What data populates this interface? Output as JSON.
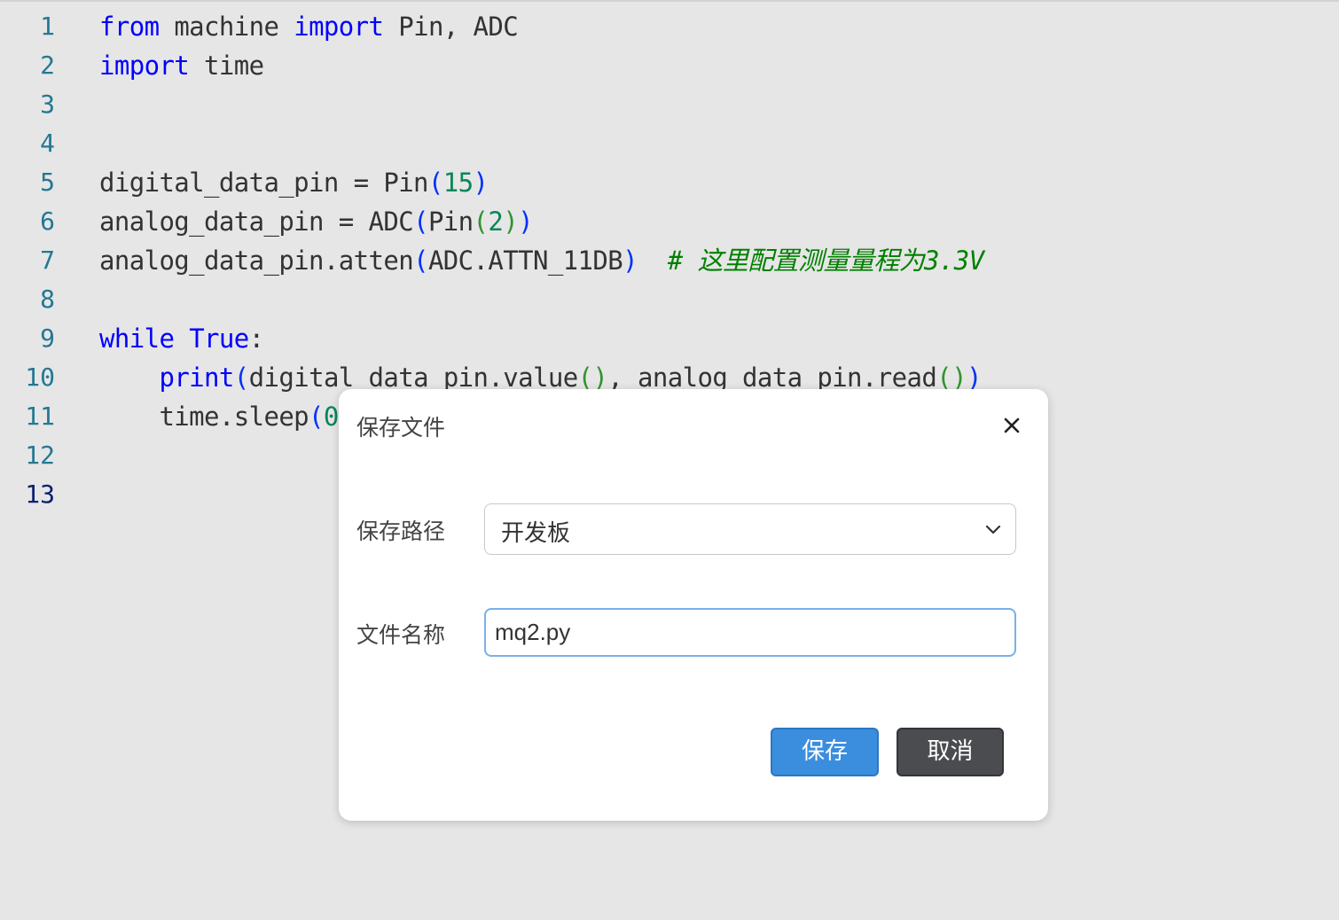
{
  "editor": {
    "lines": [
      {
        "number": "1",
        "tokens": [
          {
            "text": "from",
            "cls": "kw"
          },
          {
            "text": " machine ",
            "cls": ""
          },
          {
            "text": "import",
            "cls": "kw"
          },
          {
            "text": " Pin, ADC",
            "cls": ""
          }
        ]
      },
      {
        "number": "2",
        "tokens": [
          {
            "text": "import",
            "cls": "kw"
          },
          {
            "text": " time",
            "cls": ""
          }
        ]
      },
      {
        "number": "3",
        "tokens": []
      },
      {
        "number": "4",
        "tokens": []
      },
      {
        "number": "5",
        "tokens": [
          {
            "text": "digital_data_pin = Pin",
            "cls": ""
          },
          {
            "text": "(",
            "cls": "p1"
          },
          {
            "text": "15",
            "cls": "num"
          },
          {
            "text": ")",
            "cls": "p1"
          }
        ]
      },
      {
        "number": "6",
        "tokens": [
          {
            "text": "analog_data_pin = ADC",
            "cls": ""
          },
          {
            "text": "(",
            "cls": "p1"
          },
          {
            "text": "Pin",
            "cls": ""
          },
          {
            "text": "(",
            "cls": "p2"
          },
          {
            "text": "2",
            "cls": "num"
          },
          {
            "text": ")",
            "cls": "p2"
          },
          {
            "text": ")",
            "cls": "p1"
          }
        ]
      },
      {
        "number": "7",
        "tokens": [
          {
            "text": "analog_data_pin.atten",
            "cls": ""
          },
          {
            "text": "(",
            "cls": "p1"
          },
          {
            "text": "ADC.ATTN_11DB",
            "cls": ""
          },
          {
            "text": ")",
            "cls": "p1"
          },
          {
            "text": "  # 这里配置测量量程为3.3V",
            "cls": "cm"
          }
        ]
      },
      {
        "number": "8",
        "tokens": []
      },
      {
        "number": "9",
        "tokens": [
          {
            "text": "while",
            "cls": "kw"
          },
          {
            "text": " ",
            "cls": ""
          },
          {
            "text": "True",
            "cls": "kw"
          },
          {
            "text": ":",
            "cls": ""
          }
        ]
      },
      {
        "number": "10",
        "tokens": [
          {
            "text": "    ",
            "cls": ""
          },
          {
            "text": "print",
            "cls": "kw"
          },
          {
            "text": "(",
            "cls": "p1"
          },
          {
            "text": "digital_data_pin.value",
            "cls": ""
          },
          {
            "text": "()",
            "cls": "p2"
          },
          {
            "text": ", analog_data_pin.read",
            "cls": ""
          },
          {
            "text": "()",
            "cls": "p2"
          },
          {
            "text": ")",
            "cls": "p1"
          }
        ]
      },
      {
        "number": "11",
        "tokens": [
          {
            "text": "    time.sleep",
            "cls": ""
          },
          {
            "text": "(",
            "cls": "p1"
          },
          {
            "text": "0",
            "cls": "num"
          }
        ]
      },
      {
        "number": "12",
        "tokens": []
      },
      {
        "number": "13",
        "tokens": [],
        "active": true
      }
    ]
  },
  "dialog": {
    "title": "保存文件",
    "close_icon": "close-icon",
    "path_label": "保存路径",
    "path_value": "开发板",
    "path_options": [
      "开发板"
    ],
    "filename_label": "文件名称",
    "filename_value": "mq2.py",
    "save_label": "保存",
    "cancel_label": "取消"
  },
  "colors": {
    "keyword": "#0000ff",
    "number": "#098658",
    "comment": "#008000",
    "line_number": "#237893",
    "save_button": "#3b8ede",
    "cancel_button": "#4a4c4f"
  }
}
